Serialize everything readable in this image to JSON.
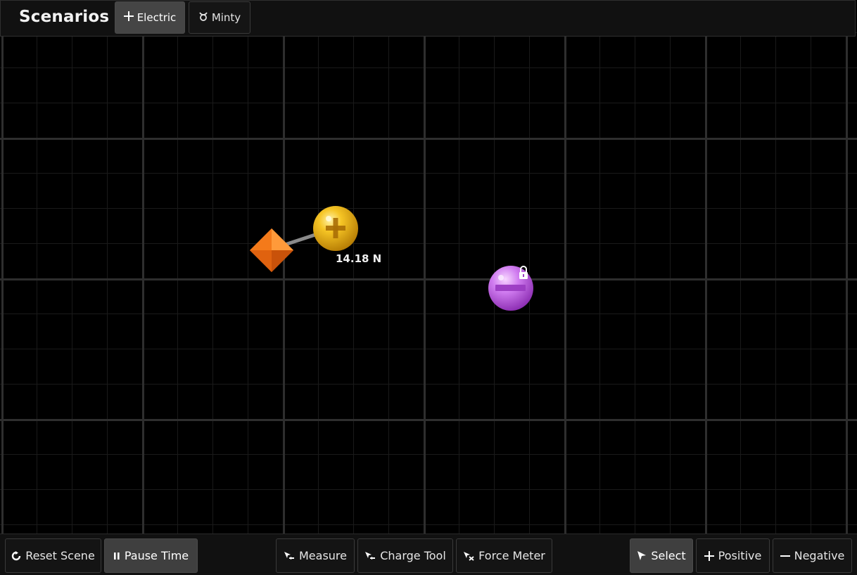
{
  "header": {
    "title": "Scenarios",
    "scenarios": [
      {
        "label": "Electric",
        "icon": "plus-icon",
        "active": true
      },
      {
        "label": "Minty",
        "icon": "taurus-icon",
        "active": false
      }
    ]
  },
  "scene": {
    "force_readout": "14.18 N",
    "positive_charge": {
      "color": "#f2b81a"
    },
    "negative_charge": {
      "color": "#c66ae6",
      "locked": true
    },
    "force_meter_probe": {
      "color": "#f06a0c"
    }
  },
  "toolbar": {
    "reset_label": "Reset Scene",
    "pause_label": "Pause Time",
    "measure_label": "Measure",
    "charge_tool_label": "Charge Tool",
    "force_meter_label": "Force Meter",
    "select_label": "Select",
    "positive_label": "Positive",
    "negative_label": "Negative",
    "active_tool": "Select"
  },
  "colors": {
    "background": "#000000",
    "bar_background": "#111111",
    "active_button": "#454545"
  }
}
